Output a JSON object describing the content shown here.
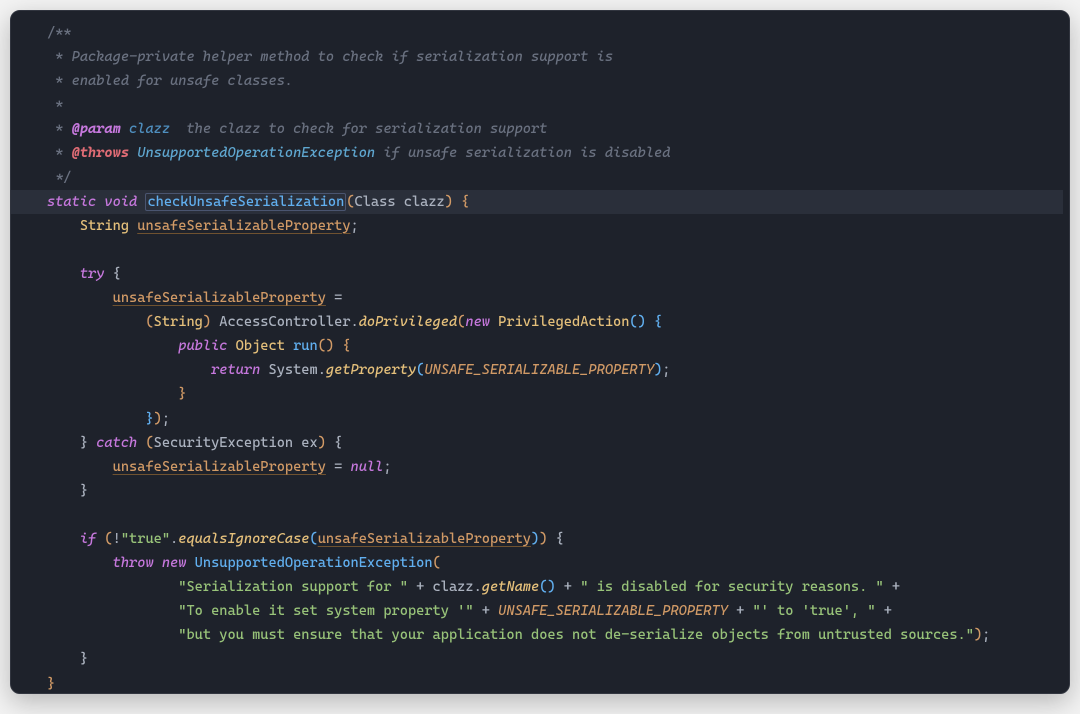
{
  "colors": {
    "background": "#1e222b",
    "line_highlight": "#2a2f3a",
    "foreground": "#abb2bf",
    "comment": "#6a7180",
    "keyword": "#c678dd",
    "method_blue": "#61afef",
    "method_yellow_italic": "#e5c07b",
    "type_orange": "#e5c07b",
    "variable_underlined": "#d19a66",
    "string": "#98c379",
    "constant": "#d19a66",
    "tag_param": "#c678dd",
    "tag_throws": "#e06c75"
  },
  "doc": {
    "open": "/**",
    "l1_star": " *",
    "l1_text": " Package-private helper method to check if serialization support is",
    "l2_star": " *",
    "l2_text": " enabled for unsafe classes.",
    "l3_star": " *",
    "l4_star": " *",
    "l4_tag": " @param",
    "l4_ident": " clazz",
    "l4_desc": "  the clazz to check for serialization support",
    "l5_star": " *",
    "l5_tag": " @throws",
    "l5_ident": " UnsupportedOperationException",
    "l5_desc": " if unsafe serialization is disabled",
    "close": " */"
  },
  "sig": {
    "mod_static": "static",
    "type_void": "void",
    "method_name": "checkUnsafeSerialization",
    "lparen": "(",
    "param_type": "Class",
    "param_name": " clazz",
    "rparen": ")",
    "space": " ",
    "obrace": "{"
  },
  "decl": {
    "indent": "    ",
    "type_string": "String",
    "sp": " ",
    "var": "unsafeSerializableProperty",
    "semi": ";"
  },
  "try_open": {
    "indent": "    ",
    "try": "try",
    "sp": " ",
    "obrace": "{"
  },
  "try_assign": {
    "indent": "        ",
    "var": "unsafeSerializableProperty",
    "sp": " ",
    "eq": "=",
    "indent2": "            ",
    "lparen": "(",
    "cast_type": "String",
    "rparen": ")",
    "sp2": " ",
    "class_accessctrl": "AccessController",
    "dot": ".",
    "do_privileged": "doPrivileged",
    "lp2": "(",
    "new_kw": "new",
    "sp3": " ",
    "pa_type": "PrivilegedAction",
    "unit_lp": "(",
    "unit_rp": ")",
    "sp4": " ",
    "obrace_anon": "{"
  },
  "anon_run": {
    "indent": "                ",
    "public_kw": "public",
    "sp": " ",
    "object_type": "Object",
    "sp2": " ",
    "run_name": "run",
    "lp": "(",
    "rp": ")",
    "sp3": " ",
    "obrace": "{"
  },
  "return_line": {
    "indent": "                    ",
    "return_kw": "return",
    "sp": " ",
    "system": "System",
    "dot": ".",
    "getprop": "getProperty",
    "lp": "(",
    "const_name": "UNSAFE_SERIALIZABLE_PROPERTY",
    "rp": ")",
    "semi": ";"
  },
  "anon_run_close": {
    "indent": "                ",
    "cbrace": "}"
  },
  "anon_close": {
    "indent": "            ",
    "cbrace": "}",
    "rp": ")",
    "semi": ";"
  },
  "catch_line": {
    "indent": "    ",
    "cbrace_try": "}",
    "sp": " ",
    "catch_kw": "catch",
    "sp2": " ",
    "lp": "(",
    "ex_type": "SecurityException",
    "sp3": " ",
    "ex_name": "ex",
    "rp": ")",
    "sp4": " ",
    "obrace": "{"
  },
  "catch_body": {
    "indent": "        ",
    "var": "unsafeSerializableProperty",
    "sp": " ",
    "eq": "=",
    "sp2": " ",
    "null_kw": "null",
    "semi": ";"
  },
  "catch_close": {
    "indent": "    ",
    "cbrace": "}"
  },
  "if_line": {
    "indent": "    ",
    "if_kw": "if",
    "sp": " ",
    "lp": "(",
    "neg": "!",
    "str_true": "\"true\"",
    "dot": ".",
    "eqic": "equalsIgnoreCase",
    "lp2": "(",
    "var": "unsafeSerializableProperty",
    "rp2": ")",
    "rp": ")",
    "sp2": " ",
    "obrace": "{"
  },
  "throw_line": {
    "indent": "        ",
    "throw_kw": "throw",
    "sp": " ",
    "new_kw": "new",
    "sp2": " ",
    "ex_type": "UnsupportedOperationException",
    "lp": "("
  },
  "msg1": {
    "indent": "                ",
    "s1": "\"Serialization support for \"",
    "plus1": " + ",
    "clazz": "clazz",
    "dot": ".",
    "getname": "getName",
    "lp": "(",
    "rp": ")",
    "plus2": " + ",
    "s2": "\" is disabled for security reasons. \"",
    "plus3": " +"
  },
  "msg2": {
    "indent": "                ",
    "s1": "\"To enable it set system property '\"",
    "plus1": " + ",
    "const_name": "UNSAFE_SERIALIZABLE_PROPERTY",
    "plus2": " + ",
    "s2": "\"' to 'true', \"",
    "plus3": " +"
  },
  "msg3": {
    "indent": "                ",
    "s1": "\"but you must ensure that your application does not de-serialize objects from untrusted sources.\"",
    "rp": ")",
    "semi": ";"
  },
  "if_close": {
    "indent": "    ",
    "cbrace": "}"
  },
  "method_close": {
    "cbrace": "}"
  }
}
